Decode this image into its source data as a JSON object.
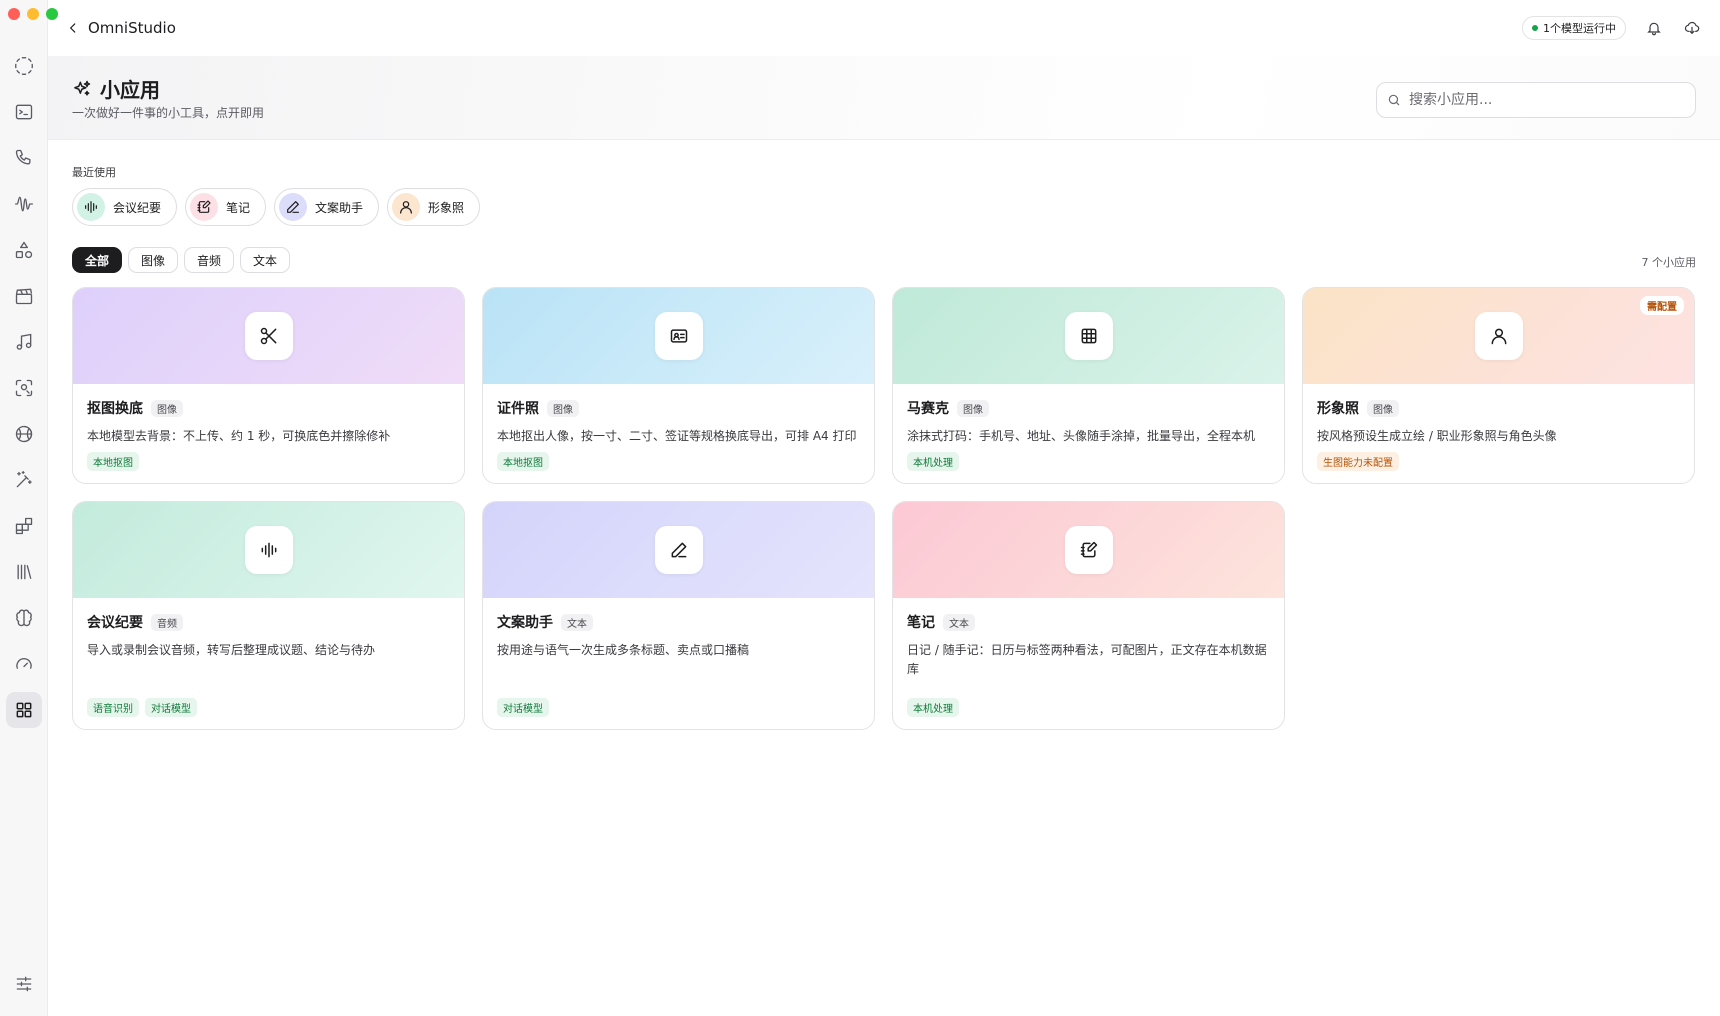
{
  "app": {
    "title": "OmniStudio",
    "status": "1个模型运行中",
    "colors": {
      "accent_dark": "#1d1d1f",
      "status_green": "#16a34a",
      "tag_green": "#0f7a3b",
      "warning_orange": "#b45309"
    }
  },
  "sidebar": {
    "items": [
      {
        "icon": "loader-dashed-icon"
      },
      {
        "icon": "terminal-icon"
      },
      {
        "icon": "phone-icon"
      },
      {
        "icon": "waveform-icon"
      },
      {
        "icon": "shapes-icon"
      },
      {
        "icon": "clapperboard-icon"
      },
      {
        "icon": "music-icon"
      },
      {
        "icon": "scan-face-icon"
      },
      {
        "icon": "basketball-icon"
      },
      {
        "icon": "magic-wand-icon"
      },
      {
        "icon": "blocks-icon"
      },
      {
        "icon": "library-icon"
      },
      {
        "icon": "brain-icon"
      },
      {
        "icon": "gauge-icon"
      },
      {
        "icon": "apps-grid-icon",
        "active": true
      },
      {
        "icon": "sliders-icon"
      }
    ]
  },
  "header": {
    "title": "小应用",
    "subtitle": "一次做好一件事的小工具，点开即用",
    "search_placeholder": "搜索小应用..."
  },
  "recent": {
    "label": "最近使用",
    "items": [
      {
        "label": "会议纪要",
        "icon": "waveform-icon",
        "color": "#d1f2e4"
      },
      {
        "label": "笔记",
        "icon": "notebook-pen-icon",
        "color": "#fde0e6"
      },
      {
        "label": "文案助手",
        "icon": "pen-icon",
        "color": "#dcdcfb"
      },
      {
        "label": "形象照",
        "icon": "user-icon",
        "color": "#fde6cf"
      }
    ]
  },
  "filters": {
    "tabs": [
      "全部",
      "图像",
      "音频",
      "文本"
    ],
    "active": "全部",
    "count_label": "7 个小应用"
  },
  "apps": [
    {
      "name": "抠图换底",
      "category": "图像",
      "desc": "本地模型去背景：不上传、约 1 秒，可换底色并擦除修补",
      "tags": [
        "本地抠图"
      ],
      "icon": "scissors-icon"
    },
    {
      "name": "证件照",
      "category": "图像",
      "desc": "本地抠出人像，按一寸、二寸、签证等规格换底导出，可排 A4 打印",
      "tags": [
        "本地抠图"
      ],
      "icon": "id-card-icon"
    },
    {
      "name": "马赛克",
      "category": "图像",
      "desc": "涂抹式打码：手机号、地址、头像随手涂掉，批量导出，全程本机",
      "tags": [
        "本机处理"
      ],
      "icon": "grid-icon"
    },
    {
      "name": "形象照",
      "category": "图像",
      "desc": "按风格预设生成立绘 / 职业形象照与角色头像",
      "tags": [
        "生图能力未配置"
      ],
      "badge": "需配置",
      "icon": "user-icon"
    },
    {
      "name": "会议纪要",
      "category": "音频",
      "desc": "导入或录制会议音频，转写后整理成议题、结论与待办",
      "tags": [
        "语音识别",
        "对话模型"
      ],
      "icon": "waveform-icon"
    },
    {
      "name": "文案助手",
      "category": "文本",
      "desc": "按用途与语气一次生成多条标题、卖点或口播稿",
      "tags": [
        "对话模型"
      ],
      "icon": "pen-icon"
    },
    {
      "name": "笔记",
      "category": "文本",
      "desc": "日记 / 随手记：日历与标签两种看法，可配图片，正文存在本机数据库",
      "tags": [
        "本机处理"
      ],
      "icon": "notebook-pen-icon"
    }
  ]
}
